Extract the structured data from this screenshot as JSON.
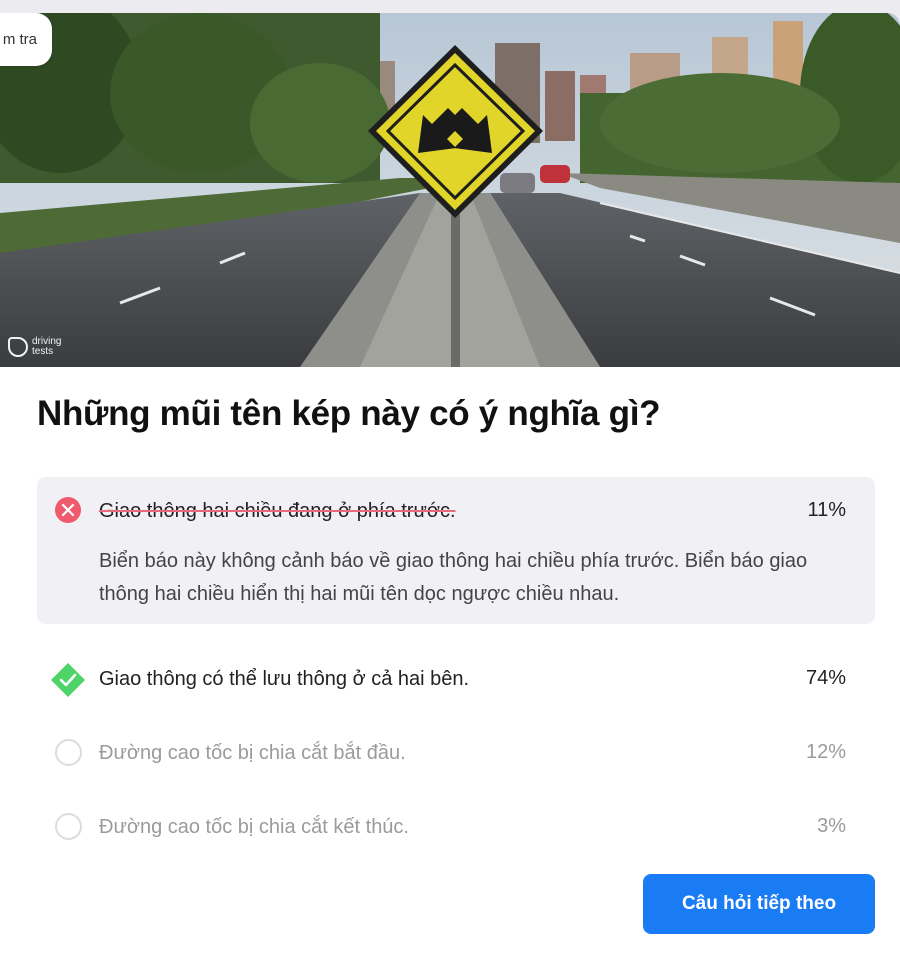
{
  "header": {
    "back_label": "m tra"
  },
  "hero": {
    "watermark": "driving tests",
    "sign_icon": "divided-road-arrows-sign"
  },
  "question": {
    "title": "Những mũi tên kép này có ý nghĩa gì?"
  },
  "answers": [
    {
      "text": "Giao thông hai chiều đang ở phía trước.",
      "percent": "11%",
      "status": "wrong",
      "explanation": "Biển báo này không cảnh báo về giao thông hai chiều phía trước. Biển báo giao thông hai chiều hiển thị hai mũi tên dọc ngược chiều nhau."
    },
    {
      "text": "Giao thông có thể lưu thông ở cả hai bên.",
      "percent": "74%",
      "status": "correct"
    },
    {
      "text": "Đường cao tốc bị chia cắt bắt đầu.",
      "percent": "12%",
      "status": "unselected"
    },
    {
      "text": "Đường cao tốc bị chia cắt kết thúc.",
      "percent": "3%",
      "status": "unselected"
    }
  ],
  "footer": {
    "next_button": "Câu hỏi tiếp theo"
  },
  "colors": {
    "accent": "#1a7cf5",
    "wrong": "#ef5b6c",
    "correct": "#4ed466",
    "wrong_bg": "#f1f0f5"
  }
}
